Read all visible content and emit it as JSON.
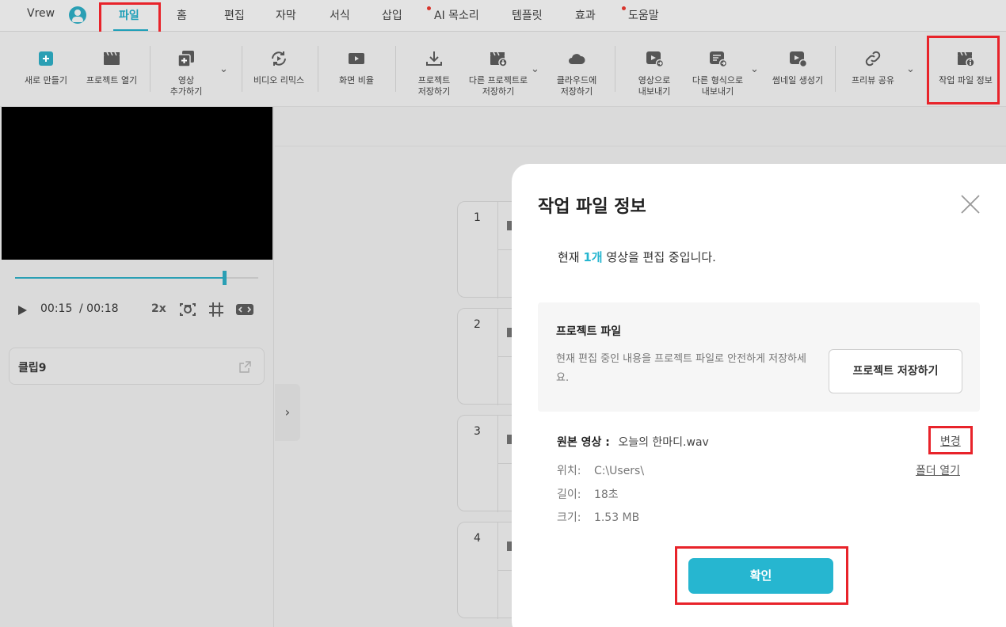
{
  "menubar": {
    "app_name": "Vrew",
    "items": [
      "파일",
      "홈",
      "편집",
      "자막",
      "서식",
      "삽입",
      "AI 목소리",
      "템플릿",
      "효과",
      "도움말"
    ]
  },
  "toolbar": {
    "new": "새로 만들기",
    "open": "프로젝트 열기",
    "add_video": "영상\n추가하기",
    "remix": "비디오 리믹스",
    "ratio": "화면 비율",
    "save": "프로젝트\n저장하기",
    "save_as": "다른 프로젝트로\n저장하기",
    "cloud": "클라우드에\n저장하기",
    "export_video": "영상으로\n내보내기",
    "export_other": "다른 형식으로\n내보내기",
    "thumbnail": "썸네일 생성기",
    "preview_share": "프리뷰 공유",
    "file_info": "작업 파일 정보"
  },
  "player": {
    "current_time": "00:15",
    "total_time": "/ 00:18",
    "speed": "2x",
    "progress": 0.86
  },
  "clip_card": {
    "title": "클립9"
  },
  "clip_numbers": [
    "1",
    "2",
    "3",
    "4"
  ],
  "dialog": {
    "title": "작업 파일 정보",
    "summary_prefix": "현재 ",
    "summary_count": "1개",
    "summary_suffix": " 영상을 편집 중입니다.",
    "project_heading": "프로젝트 파일",
    "project_desc": "현재 편집 중인 내용을 프로젝트 파일로 안전하게 저장하세요.",
    "save_button": "프로젝트 저장하기",
    "source_label": "원본 영상 :",
    "source_name": "오늘의 한마디.wav",
    "change_link": "변경",
    "location_label": "위치:",
    "location_value": "C:\\Users\\",
    "open_folder_link": "폴더 열기",
    "length_label": "길이:",
    "length_value": "18초",
    "size_label": "크기:",
    "size_value": "1.53 MB",
    "ok_button": "확인"
  },
  "colors": {
    "accent": "#26b6d0",
    "highlight_box": "#e8232a"
  }
}
